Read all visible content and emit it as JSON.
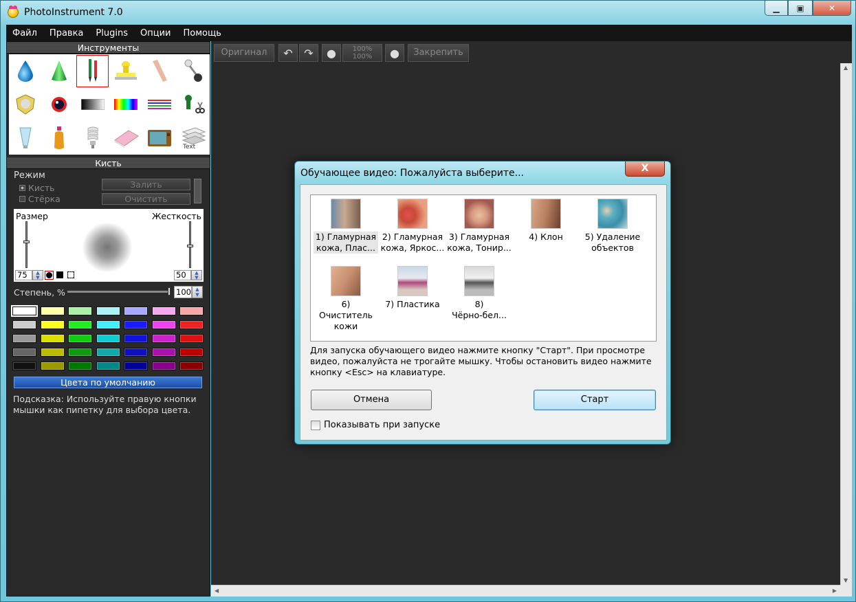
{
  "window": {
    "title": "PhotoInstrument 7.0"
  },
  "menu": [
    "Файл",
    "Правка",
    "Plugins",
    "Опции",
    "Помощь"
  ],
  "tools_panel": {
    "title": "Инструменты"
  },
  "brush_panel": {
    "title": "Кисть",
    "mode_label": "Режим",
    "radio_brush": "Кисть",
    "radio_eraser": "Стёрка",
    "fill_button": "Залить",
    "clear_button": "Очистить",
    "size_label": "Размер",
    "hardness_label": "Жесткость",
    "size_value": "75",
    "hardness_value": "50",
    "degree_label": "Степень, %",
    "degree_value": "100",
    "default_colors_button": "Цвета по умолчанию",
    "hint": "Подсказка: Используйте правую кнопки мышки как пипетку для выбора цвета.",
    "palette": [
      "#ffffff",
      "#ffffaa",
      "#a8f0a8",
      "#aaf2f8",
      "#a8a8ff",
      "#f5a8f0",
      "#f5a8a8",
      "#cccccc",
      "#ffff22",
      "#22ee22",
      "#44f0f8",
      "#1a1aff",
      "#ee44ee",
      "#ee2222",
      "#999999",
      "#dddd00",
      "#11cc11",
      "#11cccc",
      "#1111dd",
      "#cc22cc",
      "#dd1111",
      "#666666",
      "#bbbb00",
      "#119911",
      "#11aaaa",
      "#1111bb",
      "#aa11aa",
      "#bb0000",
      "#111111",
      "#999900",
      "#007700",
      "#008888",
      "#000099",
      "#880088",
      "#880000"
    ]
  },
  "toolbar": {
    "original_button": "Оригинал",
    "zoom_pct_top": "100%",
    "zoom_pct_bottom": "100%",
    "pin_button": "Закрепить"
  },
  "dialog": {
    "title": "Обучающее видео: Пожалуйста выберите...",
    "close_label": "X",
    "videos": [
      {
        "label_line1": "1) Гламурная",
        "label_line2": "кожа, Плас..."
      },
      {
        "label_line1": "2) Гламурная",
        "label_line2": "кожа, Яркос..."
      },
      {
        "label_line1": "3) Гламурная",
        "label_line2": "кожа, Тонир..."
      },
      {
        "label_line1": "4) Клон",
        "label_line2": ""
      },
      {
        "label_line1": "5) Удаление",
        "label_line2": "объектов"
      },
      {
        "label_line1": "6) Очиститель",
        "label_line2": "кожи"
      },
      {
        "label_line1": "7) Пластика",
        "label_line2": ""
      },
      {
        "label_line1": "8)",
        "label_line2": "Чёрно-бел..."
      }
    ],
    "instructions": "Для запуска обучающего видео нажмите кнопку \"Старт\". При просмотре видео, пожалуйста не трогайте мышку. Чтобы остановить видео нажмите кнопку <Esc> на клавиатуре.",
    "cancel_button": "Отмена",
    "start_button": "Старт",
    "show_on_startup": "Показывать при запуске"
  }
}
